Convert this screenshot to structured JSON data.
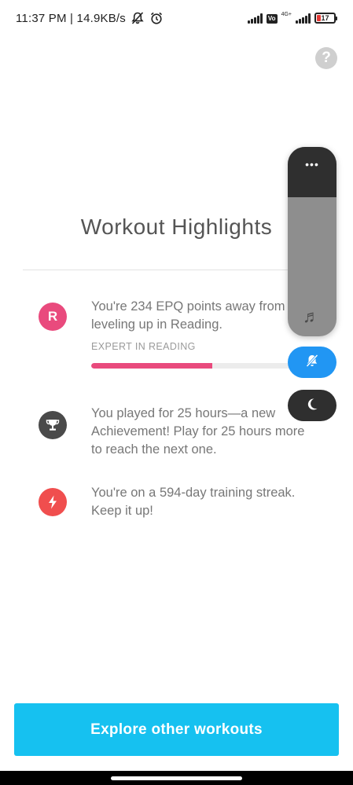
{
  "status_bar": {
    "text": "11:37 PM | 14.9KB/s",
    "volte": "Vo",
    "network": "4G+",
    "battery": "17"
  },
  "page": {
    "title": "Workout Highlights"
  },
  "highlights": [
    {
      "icon": "R",
      "text_line1": "You're 234 EPQ points away from",
      "text_line2": "leveling up in Reading.",
      "subtitle": "EXPERT IN READING",
      "progress": 0.53,
      "icon_color": "#e94a7d"
    },
    {
      "icon": "trophy-icon",
      "text_line1": "You played for 25 hours—a new",
      "text_line2": "Achievement! Play for 25 hours more",
      "text_line3": "to reach the next one.",
      "icon_color": "#4a4a4a"
    },
    {
      "icon": "lightning-icon",
      "text_line1": "You're on a 594-day training streak.",
      "text_line2": "Keep it up!",
      "icon_color": "#f04e4e"
    }
  ],
  "volume_overlay": {
    "menu_icon": "more-dots-icon",
    "media_icon": "music-note-icon",
    "ring_icon": "bell-off-icon",
    "dnd_icon": "moon-icon",
    "menu_glyph": "•••",
    "music_glyph": "♬"
  },
  "help": {
    "label": "?"
  },
  "footer": {
    "button_label": "Explore other workouts",
    "accent": "#16c1f0"
  }
}
